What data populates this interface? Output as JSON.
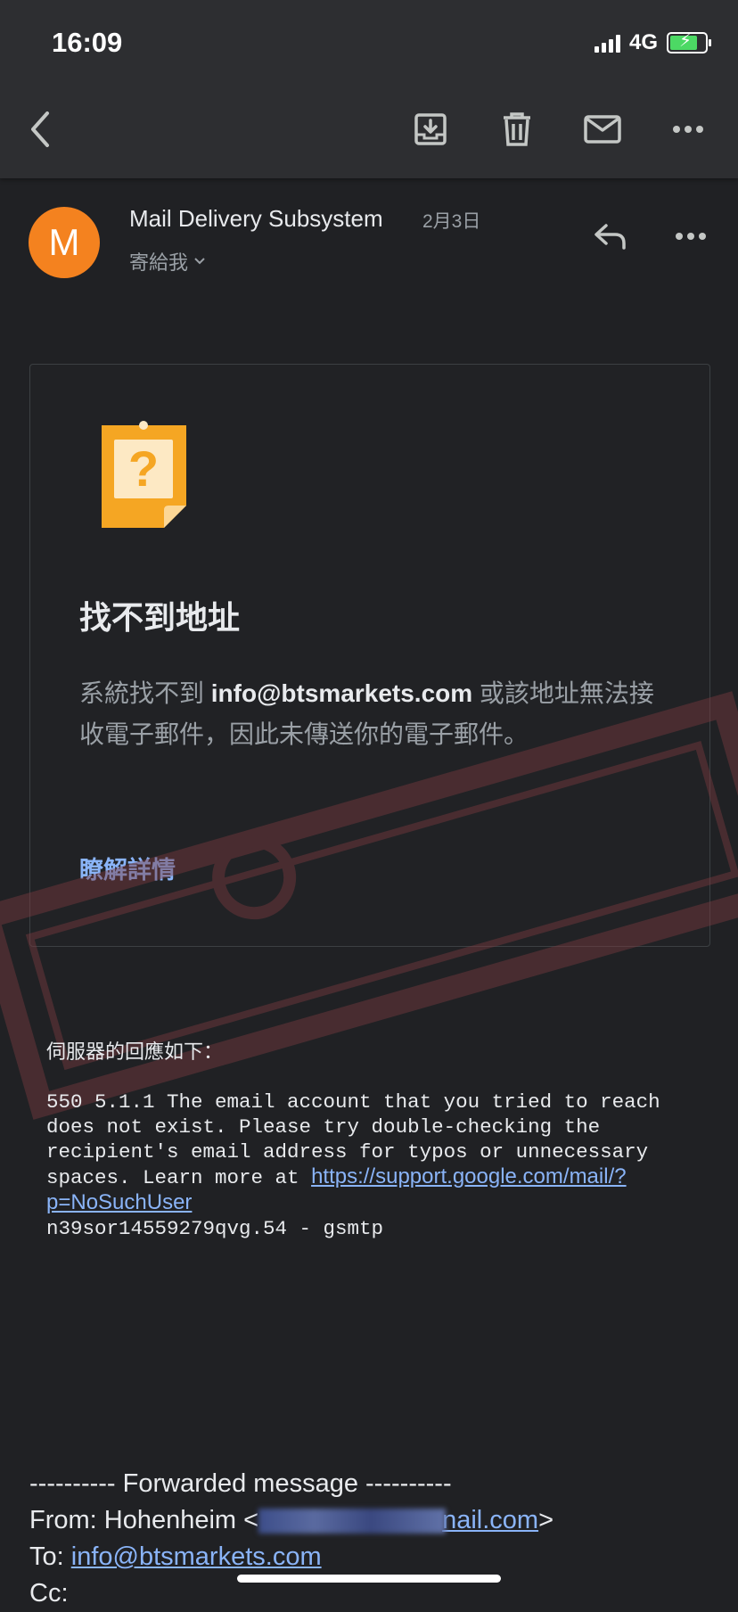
{
  "status_bar": {
    "time": "16:09",
    "network": "4G"
  },
  "toolbar": {
    "back_icon": "chevron-left-icon",
    "archive_icon": "archive-icon",
    "delete_icon": "trash-icon",
    "mark_unread_icon": "envelope-icon",
    "more_icon": "more-horizontal-icon"
  },
  "message_header": {
    "avatar_letter": "M",
    "sender": "Mail Delivery Subsystem",
    "date": "2月3日",
    "recipient_summary": "寄給我"
  },
  "bounce_card": {
    "title": "找不到地址",
    "body_before": "系統找不到 ",
    "email": "info@btsmarkets.com",
    "body_after": " 或該地址無法接收電子郵件，因此未傳送你的電子郵件。",
    "learn_more": "瞭解詳情"
  },
  "server_response": {
    "label": "伺服器的回應如下：",
    "message": "550 5.1.1 The email account that you tried to reach does not exist. Please try double-checking the recipient's email address for typos or unnecessary spaces. Learn more at ",
    "link": "https://support.google.com/mail/?p=NoSuchUser",
    "trailer": "n39sor14559279qvg.54 - gsmtp"
  },
  "forwarded": {
    "divider": "---------- Forwarded message ----------",
    "from_label": "From: Hohenheim <",
    "from_email_visible": "nail.com",
    "from_close": ">",
    "to_label": "To: ",
    "to_email": "info@btsmarkets.com",
    "cc_label": "Cc:"
  },
  "colors": {
    "background": "#202124",
    "toolbar": "#2d2e31",
    "avatar": "#f4821f",
    "link": "#8ab4f8",
    "watermark": "#7a3a3f"
  }
}
